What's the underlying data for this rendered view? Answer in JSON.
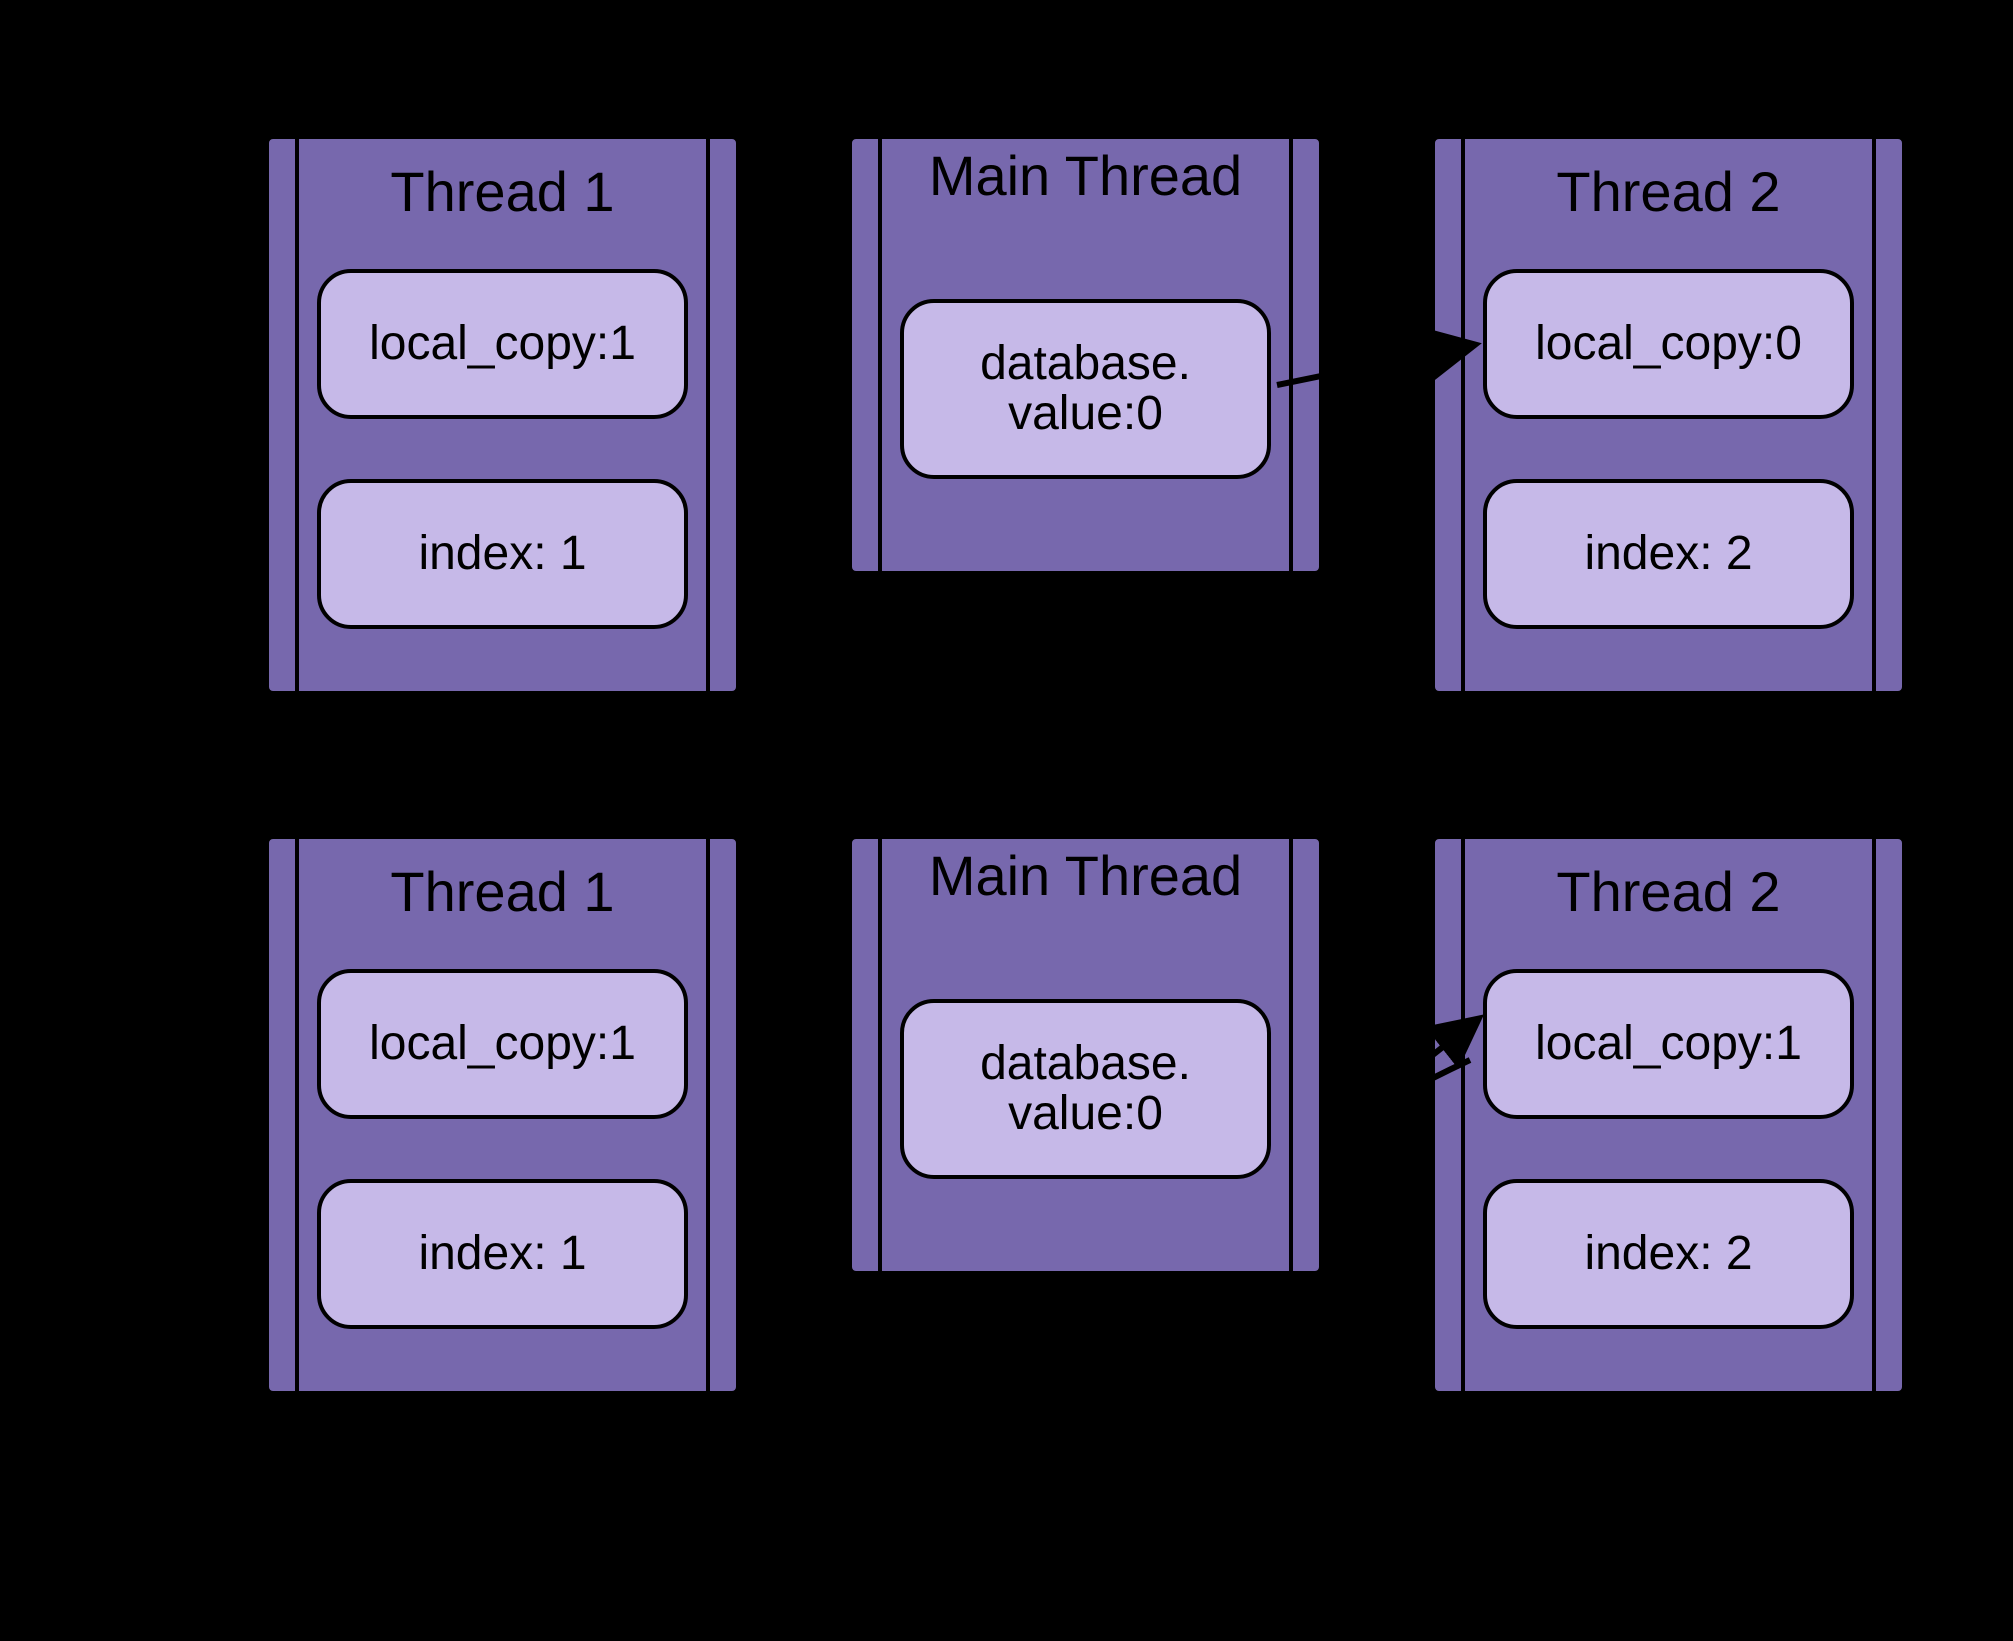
{
  "rows": [
    {
      "thread1": {
        "title": "Thread 1",
        "local_copy": "local_copy:1",
        "index": "index: 1"
      },
      "main": {
        "title": "Main Thread",
        "db": "database.\nvalue:0"
      },
      "thread2": {
        "title": "Thread 2",
        "local_copy": "local_copy:0",
        "index": "index: 2"
      }
    },
    {
      "thread1": {
        "title": "Thread 1",
        "local_copy": "local_copy:1",
        "index": "index: 1"
      },
      "main": {
        "title": "Main Thread",
        "db": "database.\nvalue:0"
      },
      "thread2": {
        "title": "Thread 2",
        "local_copy": "local_copy:1",
        "index": "index: 2"
      }
    }
  ]
}
